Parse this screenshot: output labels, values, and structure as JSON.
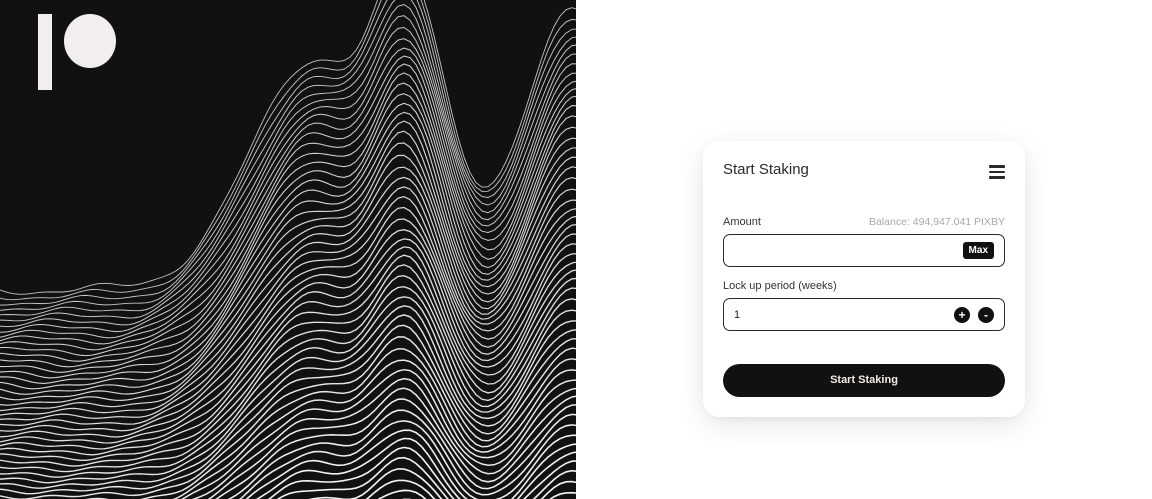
{
  "card": {
    "title": "Start Staking",
    "amount_label": "Amount",
    "balance": "Balance: 494,947.041 PIXBY",
    "amount_value": "",
    "max_label": "Max",
    "lock_label": "Lock up period (weeks)",
    "lock_value": "1",
    "plus_label": "+",
    "minus_label": "-",
    "submit_label": "Start Staking"
  },
  "icons": {
    "menu": "hamburger-icon",
    "logo": "brand-logo"
  },
  "colors": {
    "dark": "#111111",
    "logo": "#f3eeee",
    "balance_text": "#a9a9a9",
    "button_text": "#f5e9e0"
  }
}
